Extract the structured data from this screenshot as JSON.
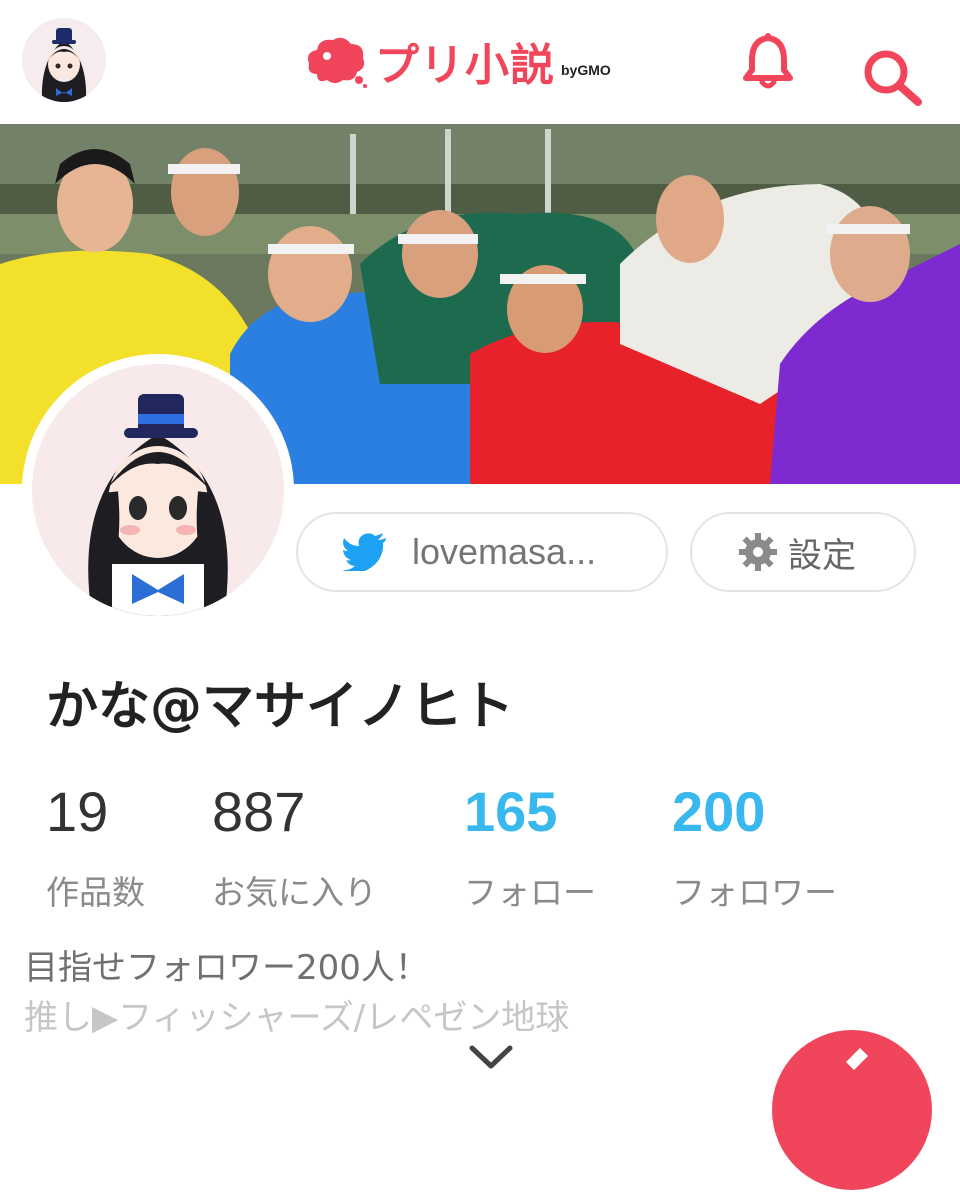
{
  "header": {
    "logo_text": "プリ小説",
    "logo_by": "byGMO",
    "brand_color": "#f0455b",
    "icons": [
      "avatar",
      "bell-icon",
      "search-icon"
    ]
  },
  "profile": {
    "twitter_handle": "lovemasa...",
    "settings_label": "設定",
    "username": "かな@マサイノヒト"
  },
  "stats": [
    {
      "value": "19",
      "label": "作品数",
      "highlight": false
    },
    {
      "value": "887",
      "label": "お気に入り",
      "highlight": false
    },
    {
      "value": "165",
      "label": "フォロー",
      "highlight": true
    },
    {
      "value": "200",
      "label": "フォロワー",
      "highlight": true
    }
  ],
  "bio": {
    "line1": "目指せフォロワー200人！",
    "line2": "推し▶フィッシャーズ/レペゼン地球"
  },
  "colors": {
    "accent": "#f0455b",
    "link_blue": "#39b8ee",
    "twitter_blue": "#1da1f2"
  }
}
